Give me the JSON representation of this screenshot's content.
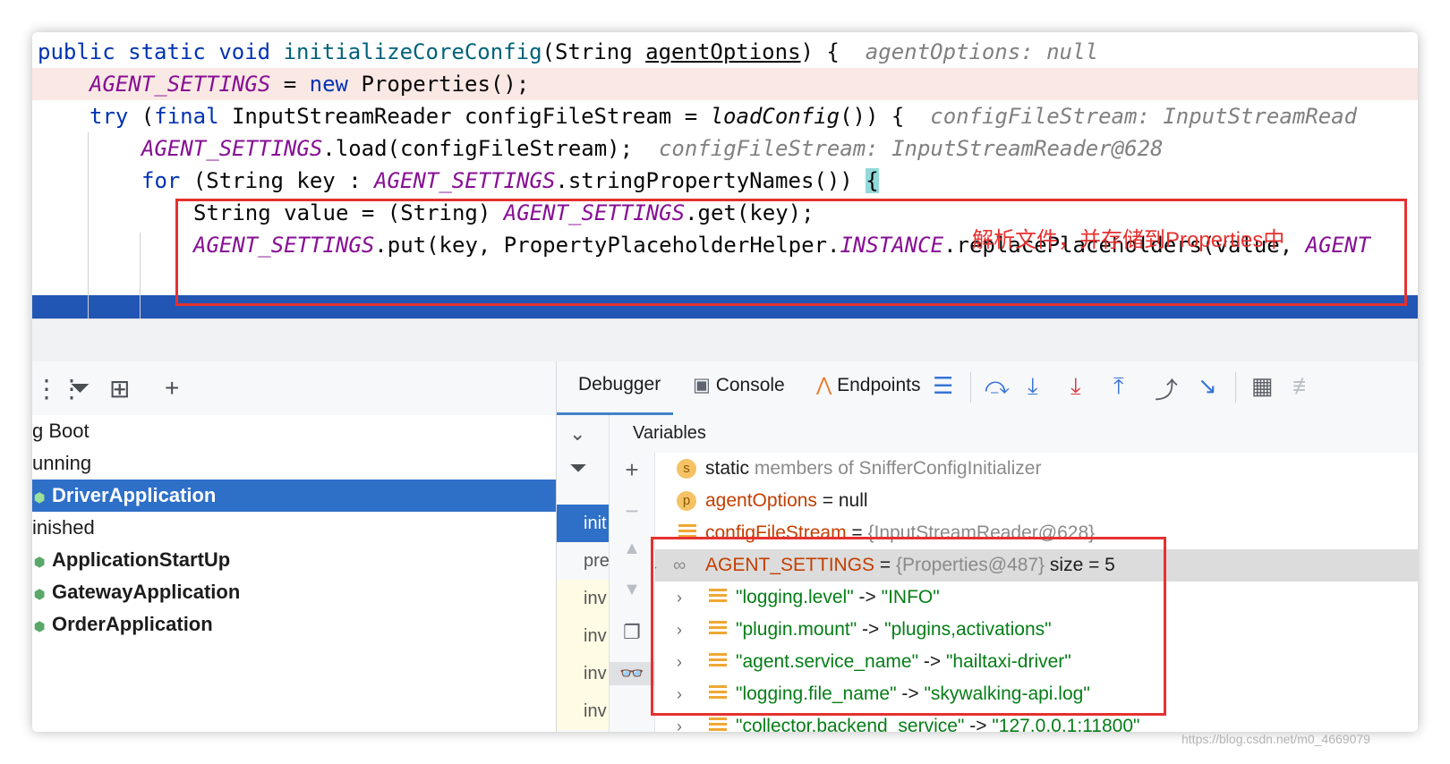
{
  "editor": {
    "lines": [
      {
        "parts": [
          "public",
          " ",
          "static",
          " ",
          "void",
          " ",
          "initializeCoreConfig",
          "(String ",
          "agentOptions",
          ") {"
        ],
        "hint": "agentOptions: null"
      },
      {
        "parts": [
          "AGENT_SETTINGS",
          " = ",
          "new",
          " Properties();"
        ]
      },
      {
        "parts": [
          "try",
          " (",
          "final",
          " InputStreamReader configFileStream = ",
          "loadConfig",
          "()) {"
        ],
        "hint": "configFileStream: InputStreamRead"
      },
      {
        "parts": [
          "AGENT_SETTINGS",
          ".load(configFileStream);"
        ],
        "hint": "configFileStream: InputStreamReader@628"
      },
      {
        "parts": [
          "for",
          " (String key : ",
          "AGENT_SETTINGS",
          ".stringPropertyNames()) ",
          "{"
        ]
      },
      {
        "parts": [
          "String value = (String) ",
          "AGENT_SETTINGS",
          ".get(key);"
        ]
      },
      {
        "parts": [
          "AGENT_SETTINGS",
          ".put(key, PropertyPlaceholderHelper.",
          "INSTANCE",
          ".replacePlaceholders(value, ",
          "AGENT"
        ]
      }
    ],
    "annotation": "解析文件，并存储到Properties中"
  },
  "run_panel": {
    "items": [
      {
        "label": "g Boot"
      },
      {
        "label": "unning"
      },
      {
        "label": "DriverApplication"
      },
      {
        "label": "inished"
      },
      {
        "label": "ApplicationStartUp"
      },
      {
        "label": "GatewayApplication"
      },
      {
        "label": "OrderApplication"
      }
    ]
  },
  "debugger": {
    "tabs": [
      "Debugger",
      "Console",
      "Endpoints"
    ],
    "variables_title": "Variables",
    "frames": [
      "init",
      "pre",
      "inv",
      "inv",
      "inv",
      "inv"
    ],
    "variables": [
      {
        "icon": "s",
        "name": "static",
        "rest": "members of SnifferConfigInitializer"
      },
      {
        "icon": "p",
        "name": "agentOptions",
        "eq": " = ",
        "value": "null"
      },
      {
        "name": "configFileStream",
        "eq": " = ",
        "value": "{InputStreamReader@628}"
      },
      {
        "name": "AGENT_SETTINGS",
        "eq": " = ",
        "value": "{Properties@487}",
        "extra": "size = 5"
      }
    ],
    "entries": [
      {
        "key": "\"logging.level\"",
        "arrow": " -> ",
        "value": "\"INFO\""
      },
      {
        "key": "\"plugin.mount\"",
        "arrow": " -> ",
        "value": "\"plugins,activations\""
      },
      {
        "key": "\"agent.service_name\"",
        "arrow": " -> ",
        "value": "\"hailtaxi-driver\""
      },
      {
        "key": "\"logging.file_name\"",
        "arrow": " -> ",
        "value": "\"skywalking-api.log\""
      },
      {
        "key": "\"collector.backend_service\"",
        "arrow": " -> ",
        "value": "\"127.0.0.1:11800\""
      }
    ]
  },
  "watermark": "https://blog.csdn.net/m0_4669079",
  "colors": {
    "keyword": "#0033b3",
    "field": "#871094",
    "method": "#00627a",
    "annotation": "#e5312f",
    "selection": "#2e6fc8"
  }
}
